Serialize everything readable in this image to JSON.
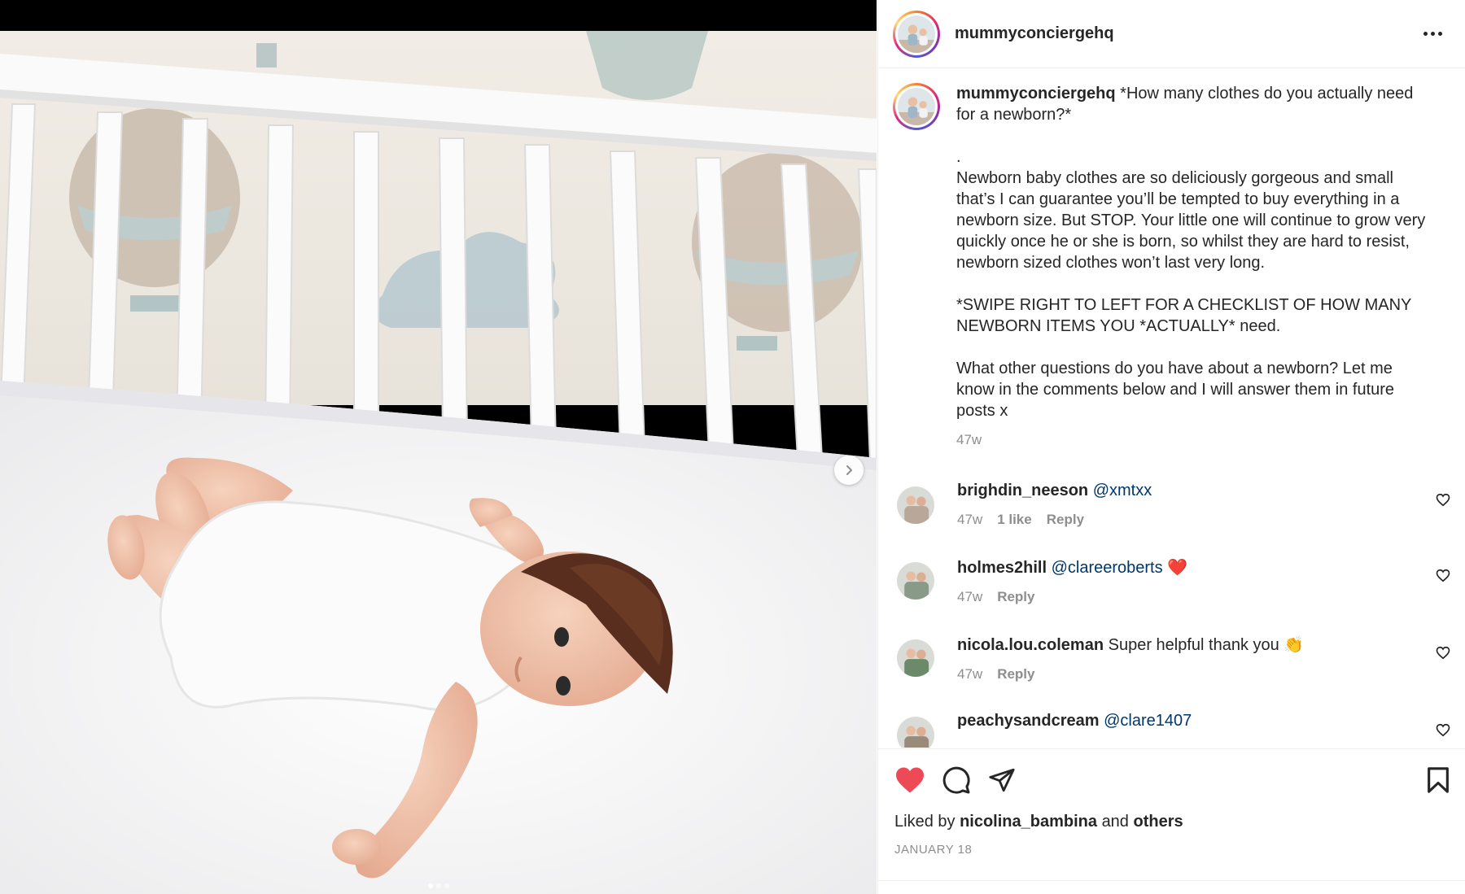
{
  "post": {
    "username": "mummyconciergehq",
    "photo_alt": "Newborn baby lying in a white cot with hot air balloon wallpaper",
    "caption_title": "*How many clothes do you actually need for a newborn?*",
    "caption_dot": ".",
    "caption_p1": "Newborn baby clothes are so deliciously gorgeous and small that’s I can guarantee you’ll be tempted to buy everything in a newborn size. But STOP. Your little one will continue to grow very quickly once he or she is born, so whilst they are hard to resist, newborn sized clothes won’t last very long.",
    "caption_p2": "*SWIPE RIGHT TO LEFT FOR A CHECKLIST OF HOW MANY NEWBORN ITEMS YOU *ACTUALLY* need.",
    "caption_p3": "What other questions do you have about a newborn? Let me know in the comments below and I will answer them in future posts x",
    "caption_time": "47w",
    "carousel_count": 3,
    "carousel_active": 0
  },
  "comments": [
    {
      "username": "brighdin_neeson",
      "mention": "@xmtxx",
      "text": "",
      "emoji": "",
      "time": "47w",
      "likes": "1 like",
      "reply": "Reply",
      "avatar_color": "#b9a89a"
    },
    {
      "username": "holmes2hill",
      "mention": "@clareeroberts",
      "text": "",
      "emoji": "❤️",
      "time": "47w",
      "likes": "",
      "reply": "Reply",
      "avatar_color": "#8a9a88"
    },
    {
      "username": "nicola.lou.coleman",
      "mention": "",
      "text": "Super helpful thank you",
      "emoji": "👏",
      "time": "47w",
      "likes": "",
      "reply": "Reply",
      "avatar_color": "#6c8a6a"
    },
    {
      "username": "peachysandcream",
      "mention": "@clare1407",
      "text": "",
      "emoji": "",
      "time": "",
      "likes": "",
      "reply": "",
      "avatar_color": "#9a8a7a"
    }
  ],
  "footer": {
    "liked_by_prefix": "Liked by",
    "liked_by_user": "nicolina_bambina",
    "liked_by_and": "and",
    "liked_by_others": "others",
    "date": "JANUARY 18"
  },
  "colors": {
    "liked_heart": "#ed4956",
    "mention": "#00376b",
    "secondary_text": "#8e8e8e"
  },
  "icons": [
    "more-icon",
    "heart-filled-icon",
    "comment-icon",
    "share-icon",
    "bookmark-icon",
    "chevron-right-icon",
    "heart-outline-icon"
  ]
}
